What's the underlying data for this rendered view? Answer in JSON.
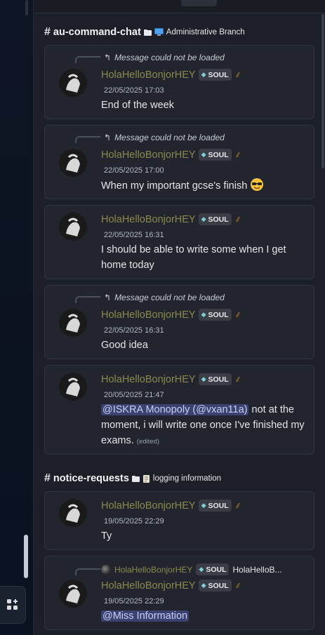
{
  "channels": [
    {
      "name": "au-command-chat",
      "category": "Administrative Branch",
      "messages": [
        {
          "reply": "Message could not be loaded",
          "author": "HolaHelloBonjorHEY",
          "role": "SOUL",
          "timestamp": "22/05/2025 17:03",
          "content": "End of the week"
        },
        {
          "reply": "Message could not be loaded",
          "author": "HolaHelloBonjorHEY",
          "role": "SOUL",
          "timestamp": "22/05/2025 17:00",
          "content": "When my important gcse's finish"
        },
        {
          "author": "HolaHelloBonjorHEY",
          "role": "SOUL",
          "timestamp": "22/05/2025 16:31",
          "content": "I should be able to write some when I get home today"
        },
        {
          "reply": "Message could not be loaded",
          "author": "HolaHelloBonjorHEY",
          "role": "SOUL",
          "timestamp": "22/05/2025 16:31",
          "content": "Good idea"
        },
        {
          "author": "HolaHelloBonjorHEY",
          "role": "SOUL",
          "timestamp": "20/05/2025 21:47",
          "mention": "@ISKRA Monopoly (@vxan11a)",
          "content": " not at the moment, i will write one once I've finished my exams.",
          "edited": "(edited)"
        }
      ]
    },
    {
      "name": "notice-requests",
      "category": "logging information",
      "messages": [
        {
          "author": "HolaHelloBonjorHEY",
          "role": "SOUL",
          "timestamp": "19/05/2025 22:29",
          "content": "Ty"
        },
        {
          "reply_author": "HolaHelloBonjorHEY",
          "reply_role": "SOUL",
          "reply_text": "HolaHelloB...",
          "author": "HolaHelloBonjorHEY",
          "role": "SOUL",
          "timestamp": "19/05/2025 22:29",
          "mention": "@Miss Information"
        }
      ]
    }
  ],
  "colors": {
    "author": "#8b8a4c",
    "mention_bg": "#3c4270",
    "card_bg": "#22252e"
  },
  "icons": {
    "reply": "reply-arrow-icon",
    "role_leaf": "leaf-icon",
    "wheat": "wheat-icon",
    "folder": "folder-icon",
    "computer": "computer-icon",
    "scroll": "scroll-icon",
    "sunglasses": "sunglasses-emoji-icon"
  }
}
